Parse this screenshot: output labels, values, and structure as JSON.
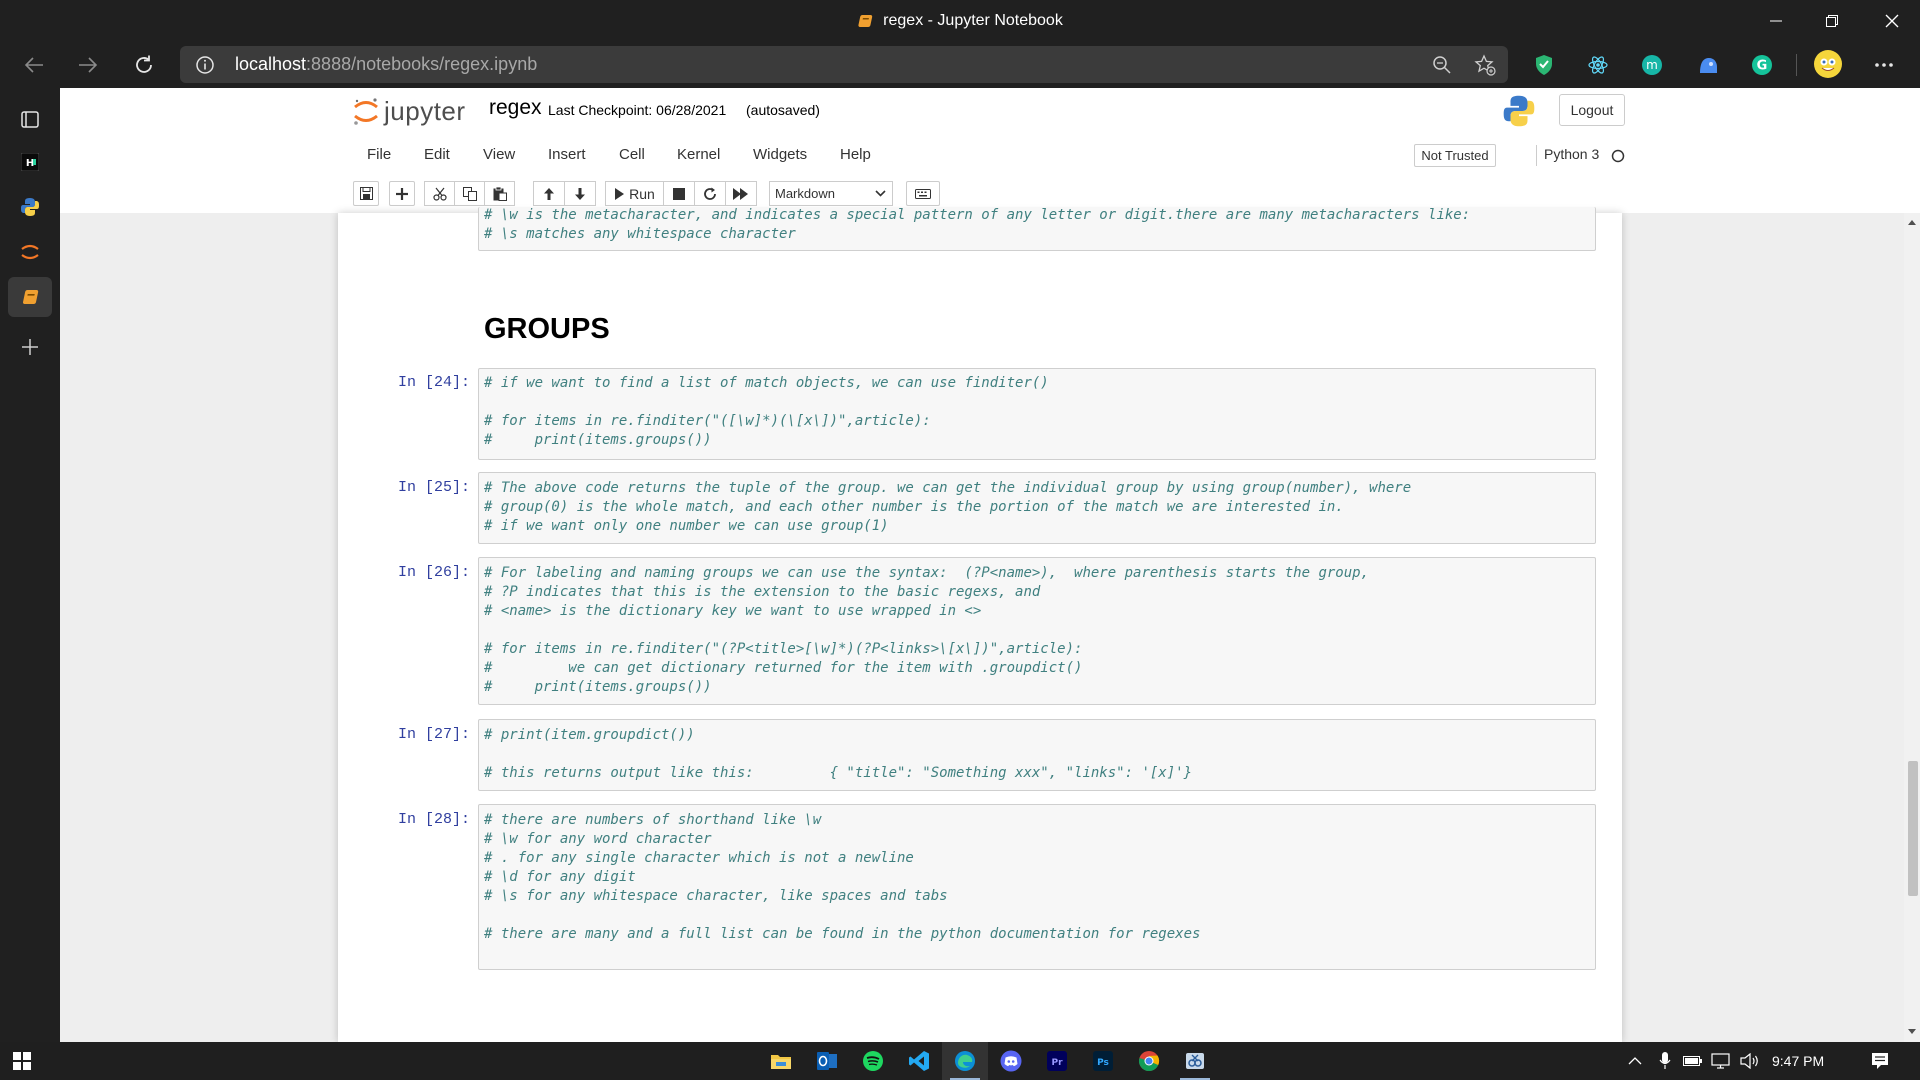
{
  "window": {
    "title": "regex - Jupyter Notebook",
    "tab_icon": "jupyter-notebook-icon"
  },
  "browser": {
    "url_host": "localhost",
    "url_path": ":8888/notebooks/regex.ipynb",
    "extensions": [
      "zoom-icon",
      "favorite-add-icon",
      "shield-extension-icon",
      "react-devtools-icon",
      "extension-m-icon",
      "extension-blue-icon",
      "grammarly-icon",
      "profile-avatar-icon",
      "more-icon"
    ]
  },
  "sidebar": {
    "items": [
      "tab-actions-icon",
      "hn-icon",
      "python-icon",
      "jupyter-icon",
      "notebook-icon",
      "add-icon"
    ]
  },
  "jupyter": {
    "logo_text": "jupyter",
    "notebook_name": "regex",
    "checkpoint": "Last Checkpoint: 06/28/2021",
    "autosave": "(autosaved)",
    "logout_label": "Logout",
    "trust_label": "Not Trusted",
    "kernel_label": "Python 3",
    "menu": {
      "file": "File",
      "edit": "Edit",
      "view": "View",
      "insert": "Insert",
      "cell": "Cell",
      "kernel": "Kernel",
      "widgets": "Widgets",
      "help": "Help"
    },
    "toolbar": {
      "run_label": "Run",
      "cell_type": "Markdown"
    }
  },
  "notebook": {
    "top_partial_lines": "# \\w is the metacharacter, and indicates a special pattern of any letter or digit.there are many metacharacters like:\n# \\s matches any whitespace character",
    "heading": "GROUPS",
    "cells": [
      {
        "prompt": "In [24]:",
        "code": "# if we want to find a list of match objects, we can use finditer()\n\n# for items in re.finditer(\"([\\w]*)(\\[x\\])\",article):\n#     print(items.groups())"
      },
      {
        "prompt": "In [25]:",
        "code": "# The above code returns the tuple of the group. we can get the individual group by using group(number), where\n# group(0) is the whole match, and each other number is the portion of the match we are interested in.\n# if we want only one number we can use group(1)"
      },
      {
        "prompt": "In [26]:",
        "code": "# For labeling and naming groups we can use the syntax:  (?P<name>),  where parenthesis starts the group,\n# ?P indicates that this is the extension to the basic regexs, and\n# <name> is the dictionary key we want to use wrapped in <>\n\n# for items in re.finditer(\"(?P<title>[\\w]*)(?P<links>\\[x\\])\",article):\n#         we can get dictionary returned for the item with .groupdict()\n#     print(items.groups())"
      },
      {
        "prompt": "In [27]:",
        "code": "# print(item.groupdict())\n\n# this returns output like this:         { \"title\": \"Something xxx\", \"links\": '[x]'}"
      },
      {
        "prompt": "In [28]:",
        "code": "# there are numbers of shorthand like \\w\n# \\w for any word character\n# . for any single character which is not a newline\n# \\d for any digit\n# \\s for any whitespace character, like spaces and tabs\n\n# there are many and a full list can be found in the python documentation for regexes"
      }
    ]
  },
  "taskbar": {
    "apps": [
      "file-explorer-icon",
      "outlook-icon",
      "spotify-icon",
      "vscode-icon",
      "edge-icon",
      "discord-icon",
      "premiere-icon",
      "photoshop-icon",
      "chrome-icon",
      "snipping-tool-icon"
    ],
    "time": "9:47 PM"
  },
  "colors": {
    "chrome_dark": "#202020",
    "comment_green": "#408080",
    "prompt_blue": "#303f9f",
    "jupyter_orange": "#F37726"
  }
}
